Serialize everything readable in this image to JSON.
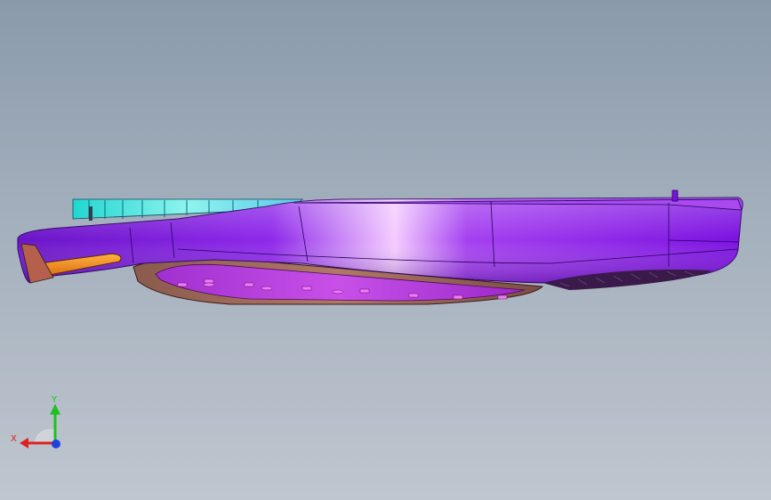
{
  "colors": {
    "background_top": "#8a9aab",
    "background_bottom": "#bfc6cf",
    "housing_purple": "#8a1ee6",
    "housing_highlight": "#f2c8ff",
    "heatsink_cyan": "#2fe0d4",
    "lens_orange": "#f08a1c",
    "underside_brown": "#9a6a5c",
    "underside_magenta": "#b63ad8",
    "axis_x": "#e02020",
    "axis_y": "#20c020",
    "axis_z": "#2040e0"
  },
  "triad": {
    "x_label": "X",
    "y_label": "Y"
  }
}
